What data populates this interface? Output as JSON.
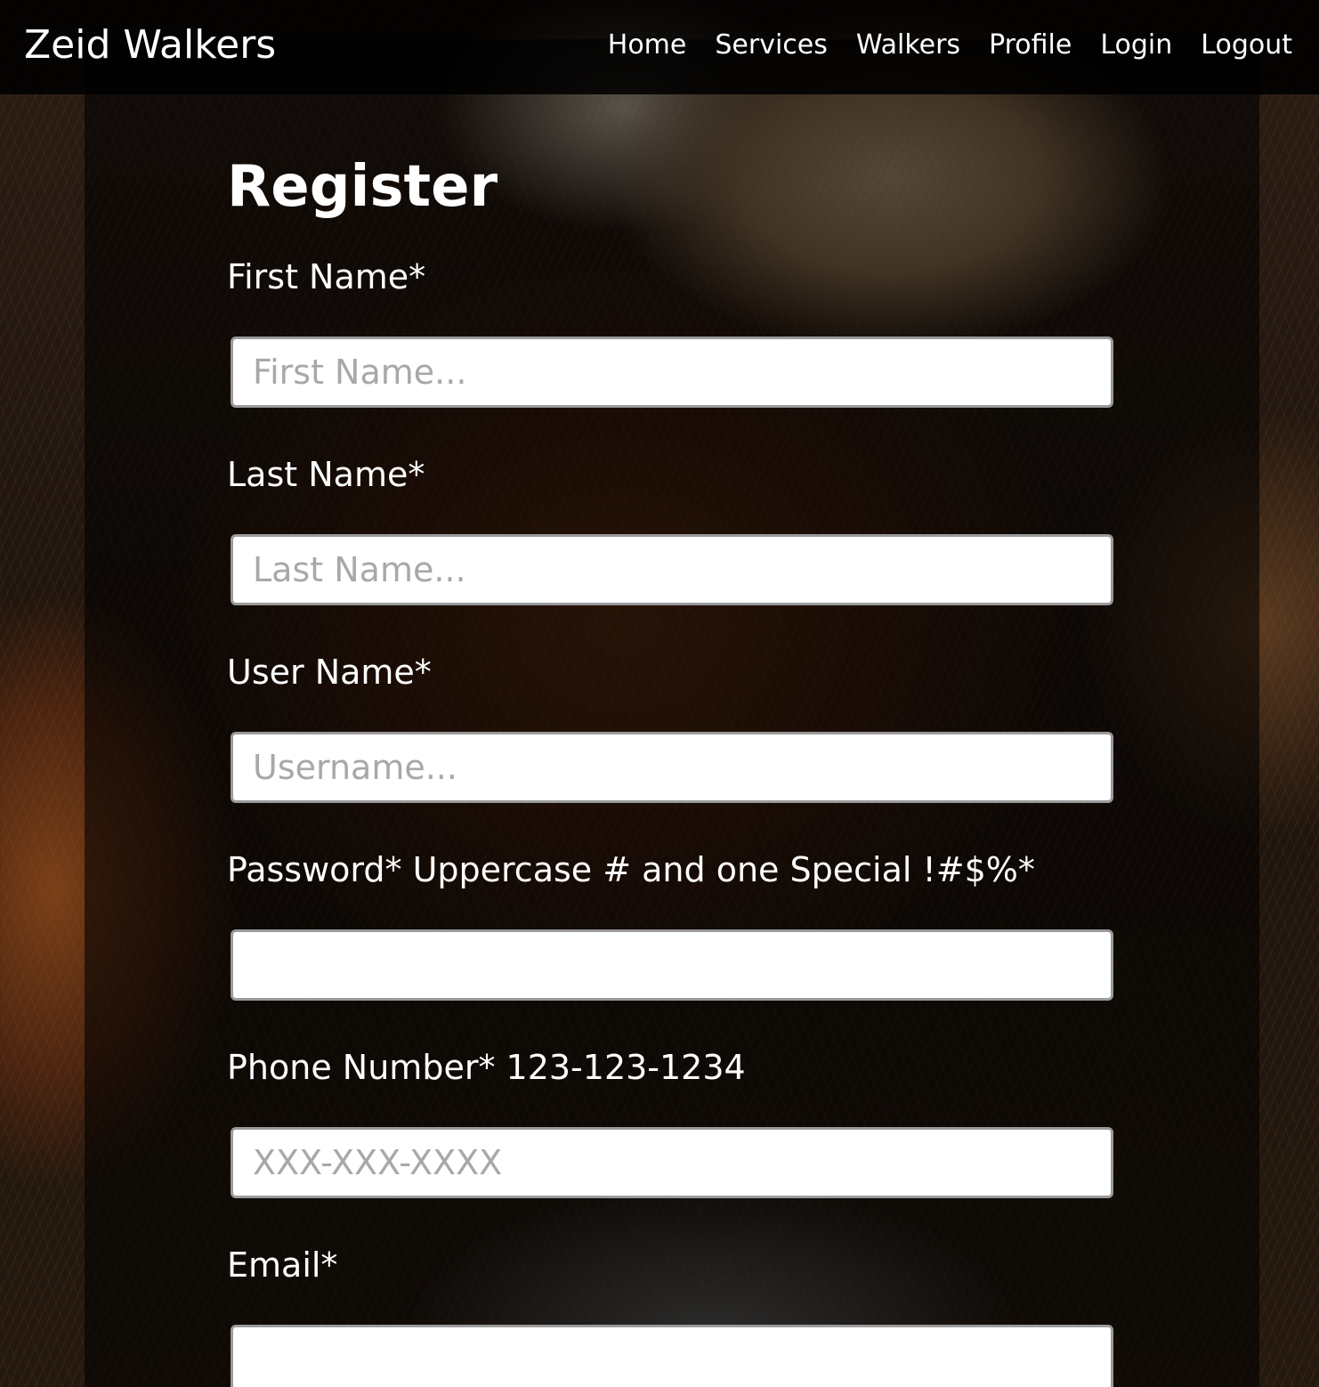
{
  "navbar": {
    "brand": "Zeid Walkers",
    "links": [
      "Home",
      "Services",
      "Walkers",
      "Profile",
      "Login",
      "Logout"
    ]
  },
  "form": {
    "title": "Register",
    "fields": [
      {
        "label": "First Name*",
        "placeholder": "First Name...",
        "value": ""
      },
      {
        "label": "Last Name*",
        "placeholder": "Last Name...",
        "value": ""
      },
      {
        "label": "User Name*",
        "placeholder": "Username...",
        "value": ""
      },
      {
        "label": "Password* Uppercase # and one Special !#$%*",
        "placeholder": "",
        "value": ""
      },
      {
        "label": "Phone Number* 123-123-1234",
        "placeholder": "XXX-XXX-XXXX",
        "value": ""
      },
      {
        "label": "Email*",
        "placeholder": "",
        "value": ""
      }
    ]
  },
  "colors": {
    "navbar_bg": "#000000",
    "text": "#ffffff",
    "input_border": "#9a9a9a",
    "placeholder": "#a8a8a8"
  }
}
